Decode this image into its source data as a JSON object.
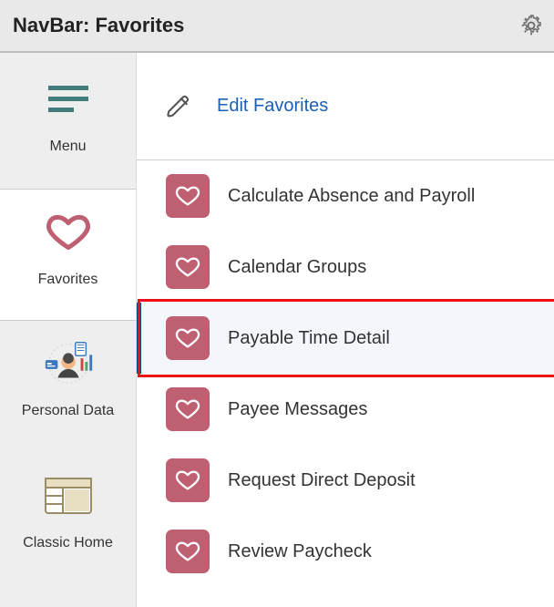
{
  "header": {
    "title": "NavBar: Favorites"
  },
  "icons": {
    "gear": "gear-icon",
    "pencil": "pencil-icon",
    "heart": "heart-icon",
    "hamburger": "hamburger-icon",
    "personal_data": "personal-data-icon",
    "classic_home": "classic-home-icon"
  },
  "sidebar": {
    "items": [
      {
        "label": "Menu",
        "icon": "hamburger"
      },
      {
        "label": "Favorites",
        "icon": "heart-outline",
        "active": true
      },
      {
        "label": "Personal Data",
        "icon": "personal-data"
      },
      {
        "label": "Classic Home",
        "icon": "classic-home"
      }
    ]
  },
  "edit": {
    "label": "Edit Favorites"
  },
  "favorites": [
    {
      "label": "Calculate Absence and Payroll"
    },
    {
      "label": "Calendar Groups"
    },
    {
      "label": "Payable Time Detail",
      "highlighted": true,
      "cursor": true
    },
    {
      "label": "Payee Messages"
    },
    {
      "label": "Request Direct Deposit"
    },
    {
      "label": "Review Paycheck"
    }
  ],
  "colors": {
    "accent": "#bf6072",
    "link": "#1a5fb4",
    "highlight_border": "#004b87",
    "callout": "#e11"
  }
}
